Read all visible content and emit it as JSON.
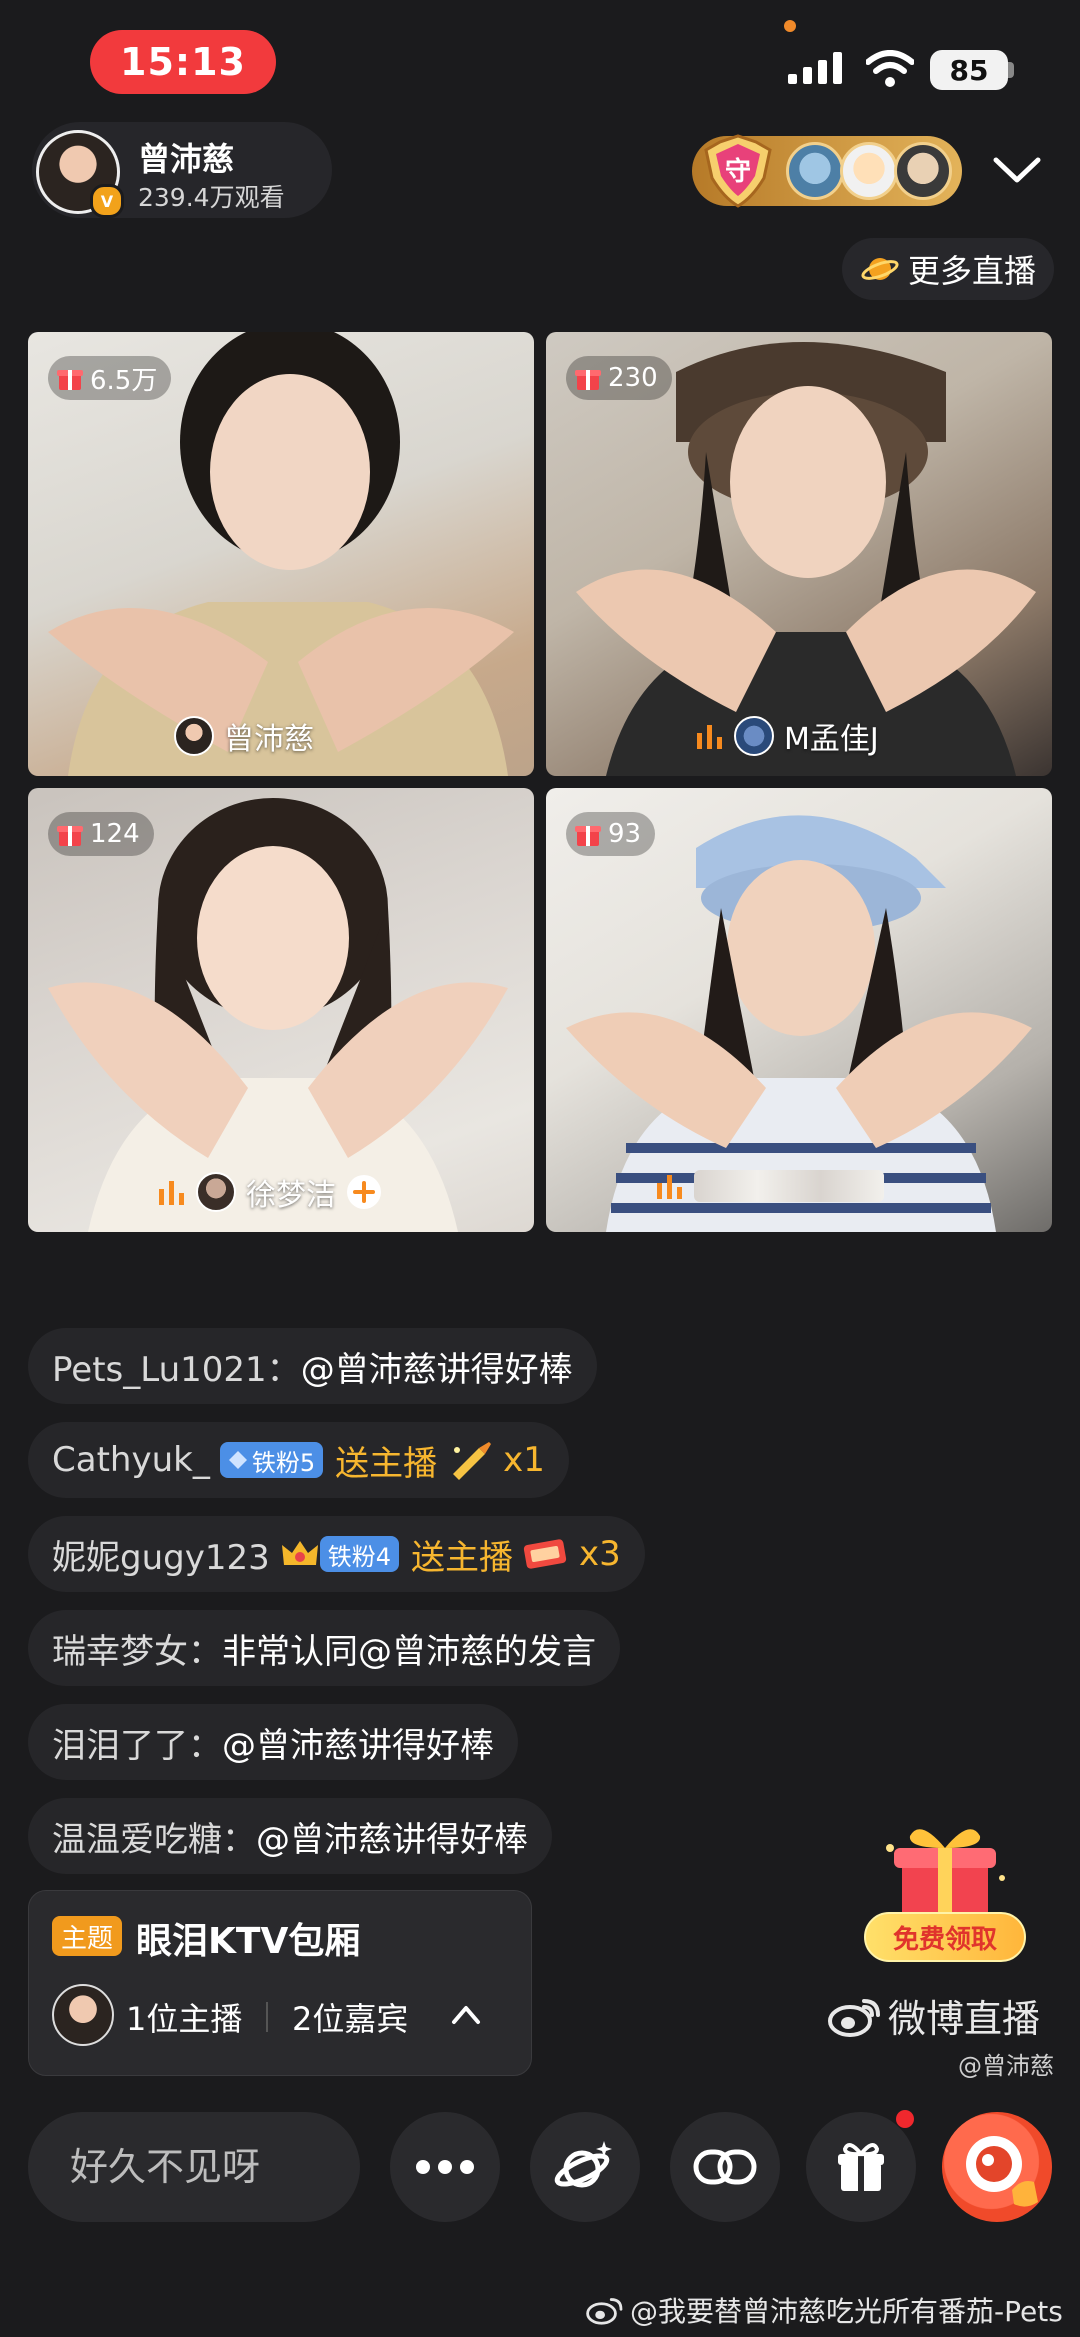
{
  "status_bar": {
    "time": "15:13",
    "battery": "85"
  },
  "header": {
    "host_name": "曾沛慈",
    "views": "239.4万观看",
    "verified_mark": "V",
    "guard_label": "守",
    "more_live_label": "更多直播"
  },
  "tiles": [
    {
      "gift_count": "6.5万",
      "name": "曾沛慈"
    },
    {
      "gift_count": "230",
      "name": "M孟佳J"
    },
    {
      "gift_count": "124",
      "name": "徐梦洁"
    },
    {
      "gift_count": "93",
      "name": ""
    }
  ],
  "chat": [
    {
      "user": "Pets_Lu1021：",
      "message": "@曾沛慈讲得好棒"
    },
    {
      "user": "Cathyuk_",
      "fan_level": "铁粉5",
      "gift_text": "送主播",
      "gift_count": "x1"
    },
    {
      "user": "妮妮gugy123",
      "fan_level": "铁粉4",
      "gift_text": "送主播",
      "gift_count": "x3"
    },
    {
      "user": "瑞幸梦女：",
      "message": "非常认同@曾沛慈的发言"
    },
    {
      "user": "泪泪了了：",
      "message": "@曾沛慈讲得好棒"
    },
    {
      "user": "温温爱吃糖：",
      "message": "@曾沛慈讲得好棒"
    }
  ],
  "topic": {
    "tag": "主题",
    "title": "眼泪KTV包厢",
    "hosts": "1位主播",
    "guests": "2位嘉宾"
  },
  "free_gift": {
    "label": "免费领取"
  },
  "brand": {
    "name": "微博直播",
    "handle": "@曾沛慈"
  },
  "input": {
    "placeholder": "好久不见呀"
  },
  "watermark": "@我要替曾沛慈吃光所有番茄-Pets",
  "icons": [
    "signal-icon",
    "wifi-icon",
    "battery-icon",
    "chevron-down-icon",
    "planet-icon",
    "gift-icon",
    "voice-bars-icon",
    "plus-icon",
    "diamond-icon",
    "crown-icon",
    "chevron-up-icon",
    "weibo-logo-icon",
    "more-icon",
    "planet-sparkle-icon",
    "link-icon",
    "mascot-icon"
  ],
  "colors": {
    "accent_red": "#f23a3d",
    "gift_text": "#f7b62f",
    "fan_tag": "#4c8fe6",
    "topic_tag": "#f19a1d",
    "background": "#1b1b1d"
  }
}
